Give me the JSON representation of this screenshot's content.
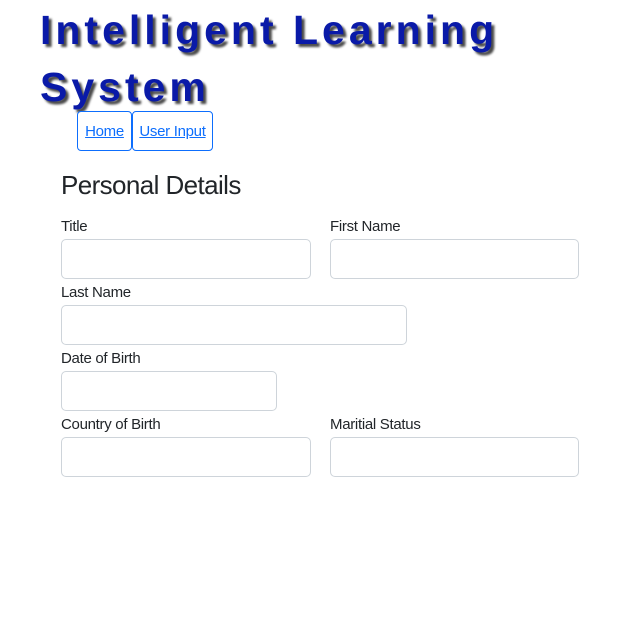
{
  "app": {
    "title": "Intelligent Learning System"
  },
  "nav": {
    "items": [
      {
        "label": "Home"
      },
      {
        "label": "User Input"
      }
    ]
  },
  "form": {
    "heading": "Personal Details",
    "fields": {
      "title": {
        "label": "Title",
        "value": "",
        "placeholder": ""
      },
      "first_name": {
        "label": "First Name",
        "value": "",
        "placeholder": ""
      },
      "last_name": {
        "label": "Last Name",
        "value": "",
        "placeholder": ""
      },
      "date_of_birth": {
        "label": "Date of Birth",
        "value": "",
        "placeholder": ""
      },
      "country_of_birth": {
        "label": "Country of Birth",
        "value": "",
        "placeholder": ""
      },
      "maritial_status": {
        "label": "Maritial Status",
        "value": "",
        "placeholder": ""
      }
    }
  },
  "colors": {
    "title_text": "#0a1aa8",
    "link": "#0d6efd",
    "input_border": "#ced4da",
    "body_text": "#212529"
  }
}
